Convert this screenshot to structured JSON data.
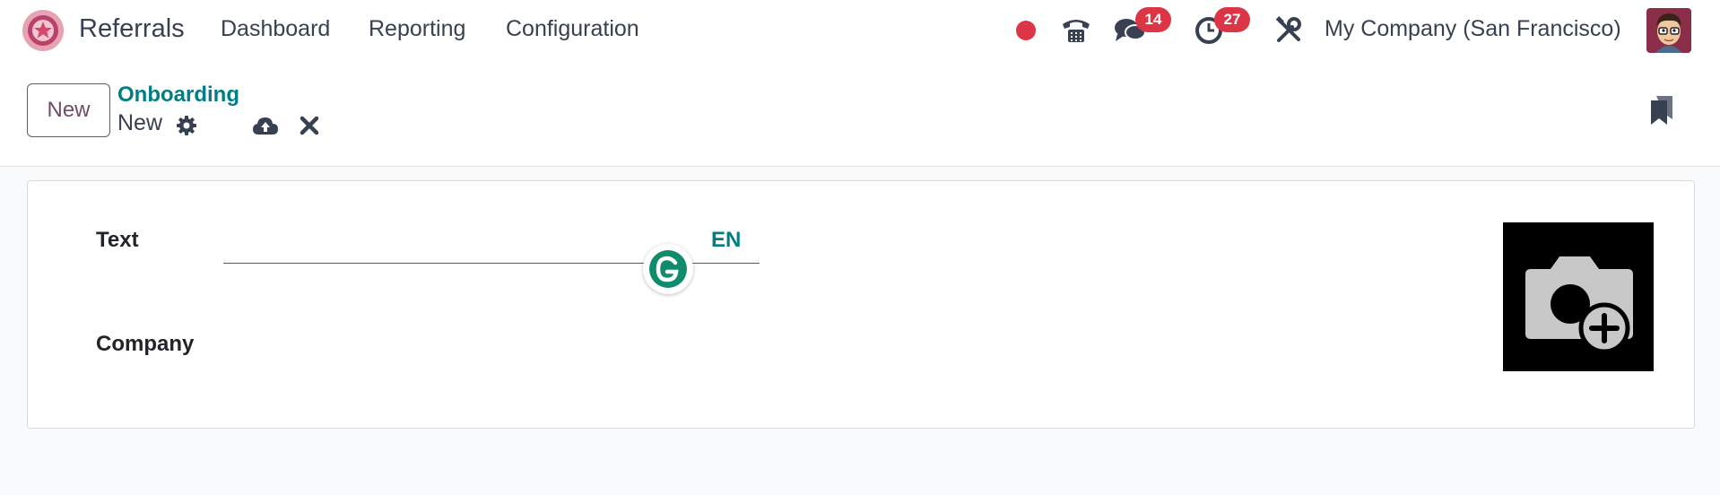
{
  "navbar": {
    "app_name": "Referrals",
    "menu": [
      {
        "label": "Dashboard"
      },
      {
        "label": "Reporting"
      },
      {
        "label": "Configuration"
      }
    ],
    "messages_count": "14",
    "activities_count": "27",
    "company": "My Company (San Francisco)",
    "icons": [
      "status-dot-icon",
      "phone-icon",
      "chat-icon",
      "clock-icon",
      "tools-icon"
    ],
    "colors": {
      "status_dot": "#dc3545",
      "badge": "#dc3545"
    }
  },
  "control_panel": {
    "new_button_label": "New",
    "breadcrumb": "Onboarding",
    "record_name": "New",
    "icons": [
      "gear-icon",
      "cloud-upload-icon",
      "discard-icon",
      "bookmark-icon"
    ]
  },
  "form": {
    "text_label": "Text",
    "text_value": "",
    "language_label": "EN",
    "company_label": "Company",
    "company_value": ""
  },
  "colors": {
    "accent": "#017e84",
    "brand": "#714b67",
    "background": "#f9fafb"
  }
}
